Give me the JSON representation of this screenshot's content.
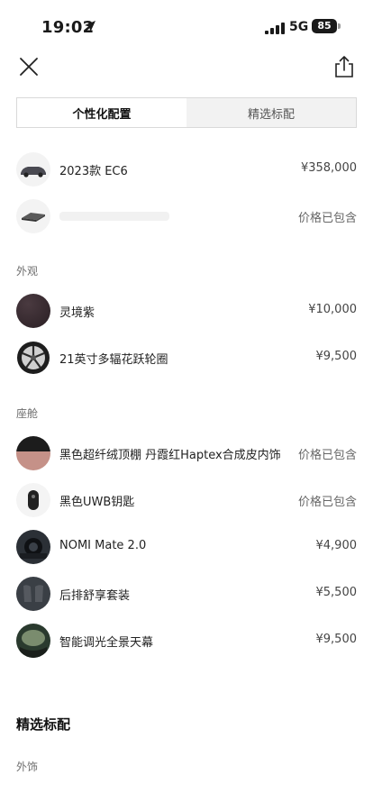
{
  "status_bar": {
    "time": "19:02",
    "network": "5G",
    "battery": "85"
  },
  "header": {
    "close_icon": "close-icon",
    "share_icon": "share-icon"
  },
  "tabs": [
    {
      "label": "个性化配置",
      "active": true
    },
    {
      "label": "精选标配",
      "active": false
    }
  ],
  "summary": [
    {
      "label": "2023款 EC6",
      "price": "¥358,000",
      "thumb": "car-thumb"
    },
    {
      "label": "",
      "price": "价格已包含",
      "thumb": "battery-pack-thumb"
    }
  ],
  "exterior": {
    "section_label": "外观",
    "items": [
      {
        "label": "灵境紫",
        "price": "¥10,000",
        "thumb": "purple-paint-swatch"
      },
      {
        "label": "21英寸多辐花跃轮圈",
        "price": "¥9,500",
        "thumb": "wheel-thumb"
      }
    ]
  },
  "cabin": {
    "section_label": "座舱",
    "items": [
      {
        "label": "黑色超纤绒顶棚 丹霞红Haptex合成皮内饰",
        "price": "价格已包含",
        "thumb": "interior-swatch"
      },
      {
        "label": "黑色UWB钥匙",
        "price": "价格已包含",
        "thumb": "key-thumb"
      },
      {
        "label": "NOMI Mate 2.0",
        "price": "¥4,900",
        "thumb": "nomi-thumb"
      },
      {
        "label": "后排舒享套装",
        "price": "¥5,500",
        "thumb": "rear-seat-thumb"
      },
      {
        "label": "智能调光全景天幕",
        "price": "¥9,500",
        "thumb": "sunroof-thumb"
      }
    ]
  },
  "standard_section": {
    "title": "精选标配",
    "sub_label": "外饰"
  },
  "colors": {
    "text": "#1a1a1a",
    "muted": "#6e6e6e",
    "tab_inactive_bg": "#f2f2f2",
    "border": "#d9d9d9"
  }
}
